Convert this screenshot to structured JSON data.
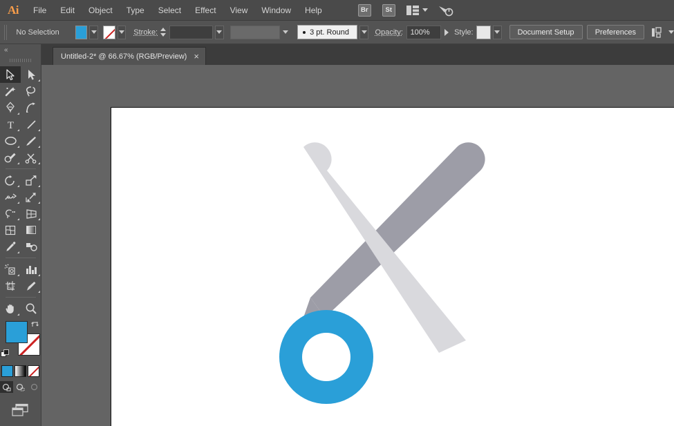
{
  "app": {
    "name": "Adobe Illustrator",
    "logo_text": "Ai"
  },
  "menubar": {
    "items": [
      {
        "label": "File"
      },
      {
        "label": "Edit"
      },
      {
        "label": "Object"
      },
      {
        "label": "Type"
      },
      {
        "label": "Select"
      },
      {
        "label": "Effect"
      },
      {
        "label": "View"
      },
      {
        "label": "Window"
      },
      {
        "label": "Help"
      }
    ],
    "bridge_badge": "Br",
    "stock_badge": "St",
    "arrange_documents_icon": "arrange-documents-icon",
    "workspace_switcher_icon": "workspace-switcher-icon"
  },
  "controlbar": {
    "selection_status": "No Selection",
    "fill_swatch_color": "#2a9fd8",
    "fill_swatch_label": "Fill color",
    "stroke_swatch_label": "Stroke color: None",
    "stroke_label": "Stroke:",
    "stroke_weight_value": "",
    "stroke_profile_value": "",
    "brush_definition": "3 pt. Round",
    "opacity_label": "Opacity:",
    "opacity_value": "100%",
    "style_label": "Style:",
    "document_setup_label": "Document Setup",
    "preferences_label": "Preferences",
    "align_icon": "align-transform-icon"
  },
  "tabbar": {
    "document_title": "Untitled-2* @ 66.67% (RGB/Preview)",
    "close_label": "×"
  },
  "toolbar": {
    "collapse_label": "«",
    "tools": [
      {
        "name": "selection-tool",
        "active": true,
        "corner": false
      },
      {
        "name": "direct-selection-tool",
        "active": false,
        "corner": true
      },
      {
        "name": "magic-wand-tool",
        "active": false,
        "corner": false
      },
      {
        "name": "lasso-tool",
        "active": false,
        "corner": false
      },
      {
        "name": "pen-tool",
        "active": false,
        "corner": true
      },
      {
        "name": "curvature-tool",
        "active": false,
        "corner": false
      },
      {
        "name": "type-tool",
        "active": false,
        "corner": true
      },
      {
        "name": "line-segment-tool",
        "active": false,
        "corner": true
      },
      {
        "name": "ellipse-tool",
        "active": false,
        "corner": true
      },
      {
        "name": "paintbrush-tool",
        "active": false,
        "corner": true
      },
      {
        "name": "shaper-pencil-tool",
        "active": false,
        "corner": true
      },
      {
        "name": "scissors-eraser-tool",
        "active": false,
        "corner": true
      },
      {
        "name": "rotate-tool",
        "active": false,
        "corner": true
      },
      {
        "name": "scale-tool",
        "active": false,
        "corner": true
      },
      {
        "name": "width-warp-tool",
        "active": false,
        "corner": true
      },
      {
        "name": "free-transform-tool",
        "active": false,
        "corner": true
      },
      {
        "name": "shape-builder-tool",
        "active": false,
        "corner": true
      },
      {
        "name": "perspective-grid-tool",
        "active": false,
        "corner": true
      },
      {
        "name": "mesh-tool",
        "active": false,
        "corner": false
      },
      {
        "name": "gradient-tool",
        "active": false,
        "corner": false
      },
      {
        "name": "eyedropper-tool",
        "active": false,
        "corner": true
      },
      {
        "name": "blend-tool",
        "active": false,
        "corner": false
      },
      {
        "name": "symbol-sprayer-tool",
        "active": false,
        "corner": true
      },
      {
        "name": "column-graph-tool",
        "active": false,
        "corner": true
      },
      {
        "name": "artboard-tool",
        "active": false,
        "corner": false
      },
      {
        "name": "slice-tool",
        "active": false,
        "corner": true
      },
      {
        "name": "hand-tool",
        "active": false,
        "corner": true
      },
      {
        "name": "zoom-tool",
        "active": false,
        "corner": false
      }
    ],
    "fill_color": "#2a9fd8",
    "stroke_color": "none",
    "swap_icon": "swap-fill-stroke-icon",
    "default_icon": "default-fill-stroke-icon",
    "color_mode_label": "Color",
    "gradient_mode_label": "Gradient",
    "none_mode_label": "None",
    "draw_normal_label": "Draw Normal",
    "draw_behind_label": "Draw Behind",
    "draw_inside_label": "Draw Inside",
    "screen_mode_label": "Change Screen Mode"
  },
  "canvas": {
    "background_color": "#646464",
    "artboard_color": "#ffffff",
    "artwork": {
      "title": "scissors-illustration",
      "blade_light_color": "#d9d9dd",
      "blade_dark_color": "#9d9da7",
      "handle_ring_color": "#2a9fd8",
      "handle_ring_hole_color": "#ffffff"
    }
  }
}
